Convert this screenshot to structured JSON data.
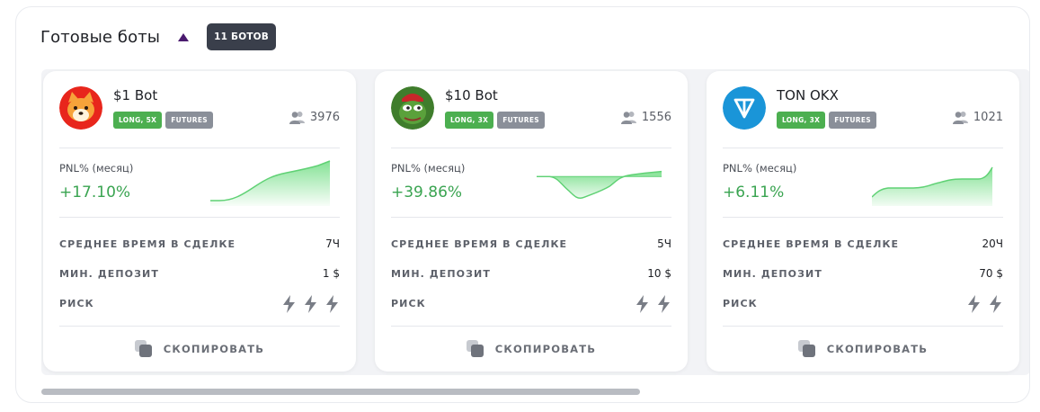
{
  "header": {
    "title": "Готовые боты",
    "badge": "11 БОТОВ"
  },
  "labels": {
    "pnl": "PNL% (месяц)",
    "avg_time": "СРЕДНЕЕ ВРЕМЯ В СДЕЛКЕ",
    "min_deposit": "МИН. ДЕПОЗИТ",
    "risk": "РИСК",
    "copy": "СКОПИРОВАТЬ"
  },
  "colors": {
    "accent_green": "#3aa451",
    "tag_green": "#4caf50",
    "tag_grey": "#8a8f99",
    "badge_dark": "#3a3f4b"
  },
  "bots": [
    {
      "name": "$1 Bot",
      "avatar_icon": "shiba-inu-icon",
      "tags": [
        "LONG, 5X",
        "FUTURES"
      ],
      "users": "3976",
      "pnl": "+17.10%",
      "avg_time": "7Ч",
      "min_deposit": "1 $",
      "risk_level": 3
    },
    {
      "name": "$10 Bot",
      "avatar_icon": "pepe-frog-icon",
      "tags": [
        "LONG, 3X",
        "FUTURES"
      ],
      "users": "1556",
      "pnl": "+39.86%",
      "avg_time": "5Ч",
      "min_deposit": "10 $",
      "risk_level": 2
    },
    {
      "name": "TON OKX",
      "avatar_icon": "ton-logo-icon",
      "tags": [
        "LONG, 3X",
        "FUTURES"
      ],
      "users": "1021",
      "pnl": "+6.11%",
      "avg_time": "20Ч",
      "min_deposit": "70 $",
      "risk_level": 2
    }
  ]
}
